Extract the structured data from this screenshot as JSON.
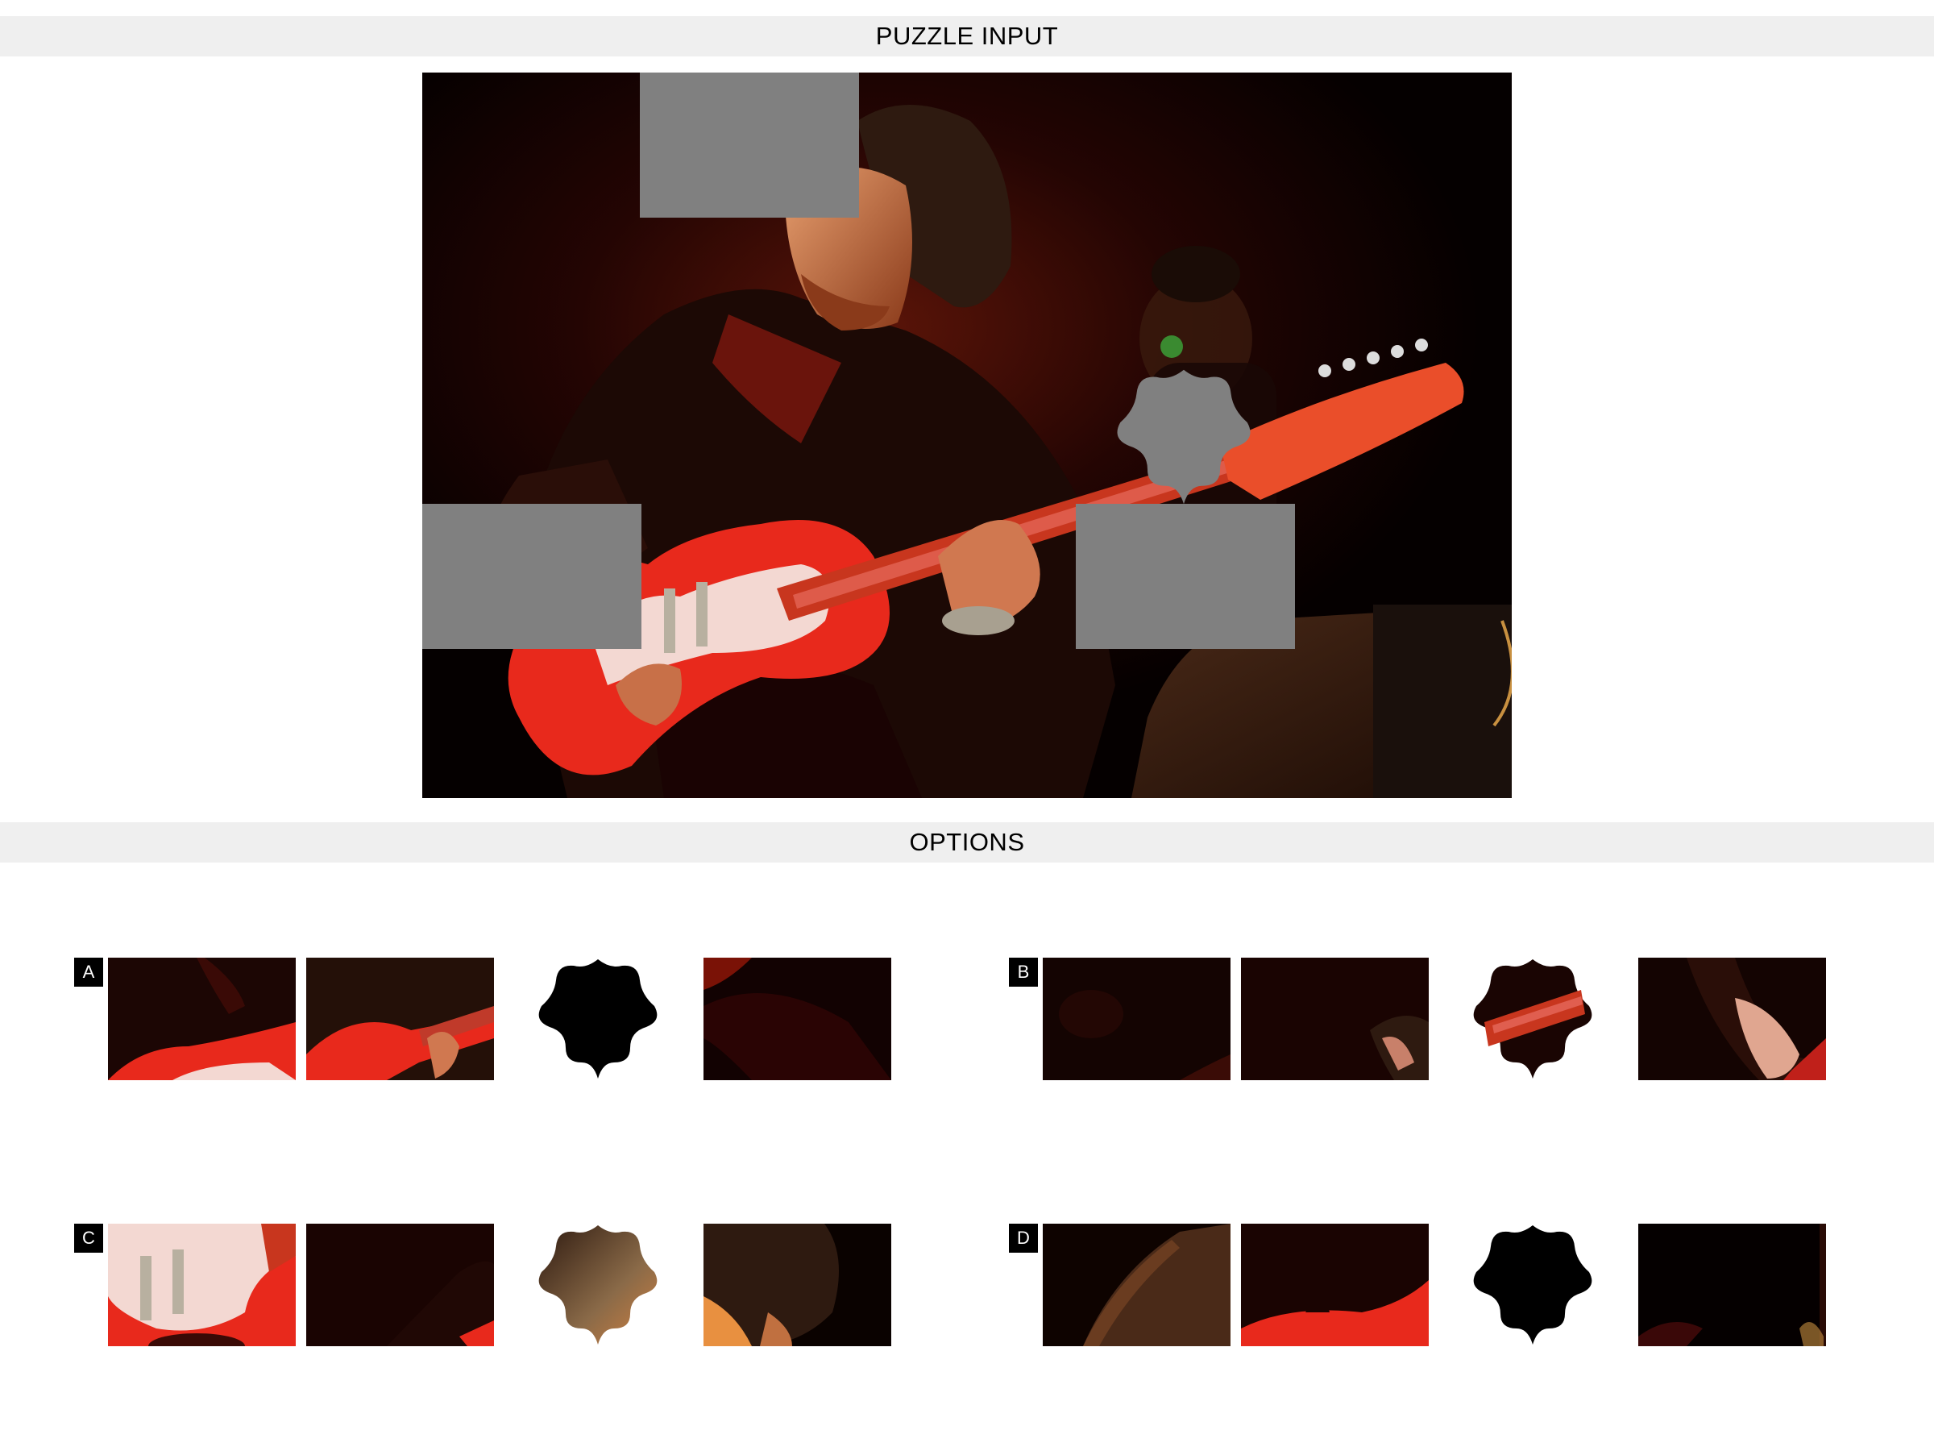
{
  "headers": {
    "puzzle_input": "PUZZLE INPUT",
    "options": "OPTIONS"
  },
  "options": [
    {
      "label": "A",
      "star_fill": "#000000",
      "tiles": [
        "guitar-body-bridge",
        "guitar-body-hand",
        "star-black",
        "dark-knee"
      ]
    },
    {
      "label": "B",
      "star_fill": "#1a0503",
      "tiles": [
        "dark-background",
        "hair-corner",
        "star-fretboard",
        "hand-on-guitar"
      ]
    },
    {
      "label": "C",
      "star_fill": "#6b4a2c",
      "tiles": [
        "guitar-pickguard",
        "dark-shoulder",
        "star-hair",
        "head-hair"
      ]
    },
    {
      "label": "D",
      "star_fill": "#000000",
      "tiles": [
        "speaker-edge",
        "guitar-edge",
        "star-black",
        "dark-corner"
      ]
    }
  ],
  "colors": {
    "hole_gray": "#808080",
    "header_bg": "#efefef",
    "guitar_red": "#e8291c",
    "pickguard": "#f3d8d2",
    "background_dark": "#070100"
  }
}
